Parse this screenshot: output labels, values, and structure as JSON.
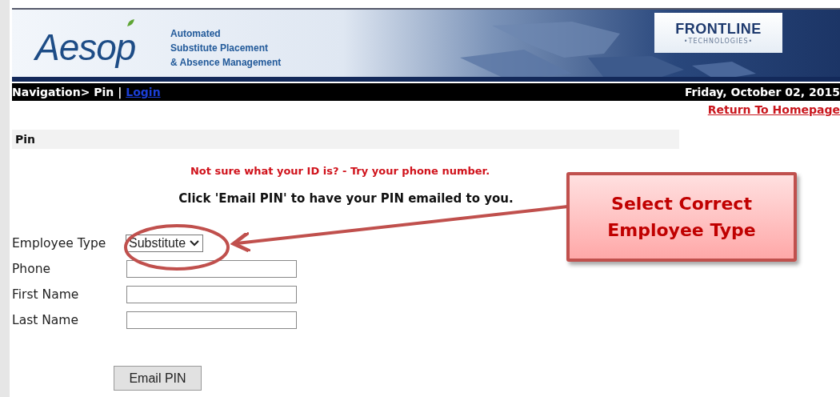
{
  "banner": {
    "logo": "Aesop",
    "tagline": [
      "Automated",
      "Substitute Placement",
      "& Absence Management"
    ],
    "partner_logo": "FRONTLINE",
    "partner_subtitle": "•TECHNOLOGIES•"
  },
  "nav_bar": {
    "breadcrumb": "Navigation> Pin |",
    "link": "Login",
    "date": "Friday, October 02, 2015"
  },
  "return_link": "Return To Homepage",
  "section_title": "Pin",
  "notice": "Not sure what your ID is? - Try your phone number.",
  "instruction": "Click 'Email PIN' to have your PIN emailed to you.",
  "fields": [
    {
      "label": "Employee Type",
      "kind": "select",
      "value": "Substitute"
    },
    {
      "label": "Phone",
      "kind": "text"
    },
    {
      "label": "First Name",
      "kind": "text"
    },
    {
      "label": "Last Name",
      "kind": "text"
    }
  ],
  "button": "Email PIN",
  "callout": {
    "lines": [
      "Select Correct",
      "Employee Type"
    ]
  }
}
